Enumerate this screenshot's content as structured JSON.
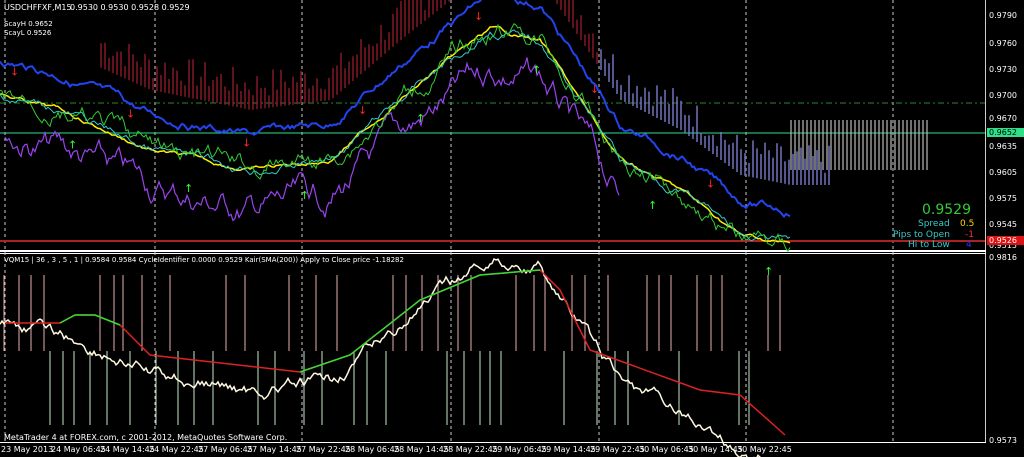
{
  "header": {
    "symbol": "USDCHFFXF,M15",
    "ohlc": "0.9530 0.9530 0.9528 0.9529",
    "scay_h": "ScayH 0.9652",
    "scay_l": "ScayL 0.9526"
  },
  "info": {
    "price": "0.9529",
    "spread_label": "Spread",
    "spread": "0.5",
    "pips_label": "Pips to Open",
    "pips": "-1",
    "hilo_label": "Hi to Low",
    "hilo": "4"
  },
  "indicator": {
    "caption": "VQM15 | 36 , 3 , 5 , 1 | 0.9584 0.9584 CycleIdentifier 0.0000 0.9529 Kair(SMA(200)) Apply to Close price -1.18282"
  },
  "footer": "MetaTrader 4 at FOREX.com, c 2001-2012, MetaQuotes Software Corp.",
  "price_axis": [
    "0.9790",
    "0.9760",
    "0.9730",
    "0.9700",
    "0.9670",
    "0.9635",
    "0.9605",
    "0.9575",
    "0.9545",
    "0.9515"
  ],
  "price_tags": {
    "green": "0.9652",
    "red": "0.9526"
  },
  "sub_axis": {
    "top": "0.9816",
    "bottom": "0.9573"
  },
  "time_axis": [
    "23 May 2013",
    "24 May 06:45",
    "24 May 14:45",
    "24 May 22:45",
    "27 May 06:45",
    "27 May 14:45",
    "27 May 22:45",
    "28 May 06:45",
    "28 May 14:45",
    "28 May 22:45",
    "29 May 06:45",
    "29 May 14:45",
    "29 May 22:45",
    "30 May 06:45",
    "30 May 14:45",
    "30 May 22:45"
  ],
  "colors": {
    "price": "#33cc33",
    "spread": "#ffd700",
    "pips": "#ff3333",
    "hilo": "#2222ff",
    "label": "#33cccc"
  }
}
